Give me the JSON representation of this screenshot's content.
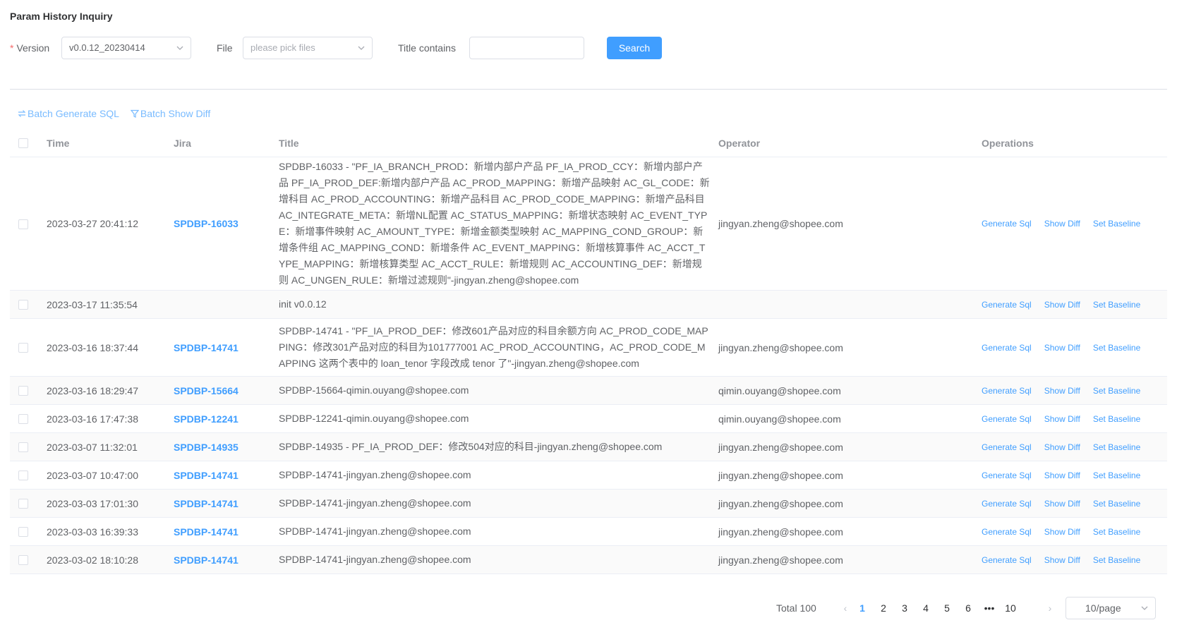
{
  "page": {
    "title": "Param History Inquiry"
  },
  "filters": {
    "version_label": "Version",
    "version_required_mark": "*",
    "version_value": "v0.0.12_20230414",
    "file_label": "File",
    "file_placeholder": "please pick files",
    "title_label": "Title contains",
    "title_value": "",
    "search_label": "Search"
  },
  "batch": {
    "generate_sql_label": "Batch Generate SQL",
    "show_diff_label": "Batch Show Diff"
  },
  "table": {
    "columns": {
      "time": "Time",
      "jira": "Jira",
      "title": "Title",
      "operator": "Operator",
      "operations": "Operations"
    },
    "op_labels": {
      "generate_sql": "Generate Sql",
      "show_diff": "Show Diff",
      "set_baseline": "Set Baseline"
    },
    "rows": [
      {
        "time": "2023-03-27 20:41:12",
        "jira": "SPDBP-16033",
        "title": "SPDBP-16033 - \"PF_IA_BRANCH_PROD：新增内部户产品 PF_IA_PROD_CCY：新增内部户产品 PF_IA_PROD_DEF:新增内部户产品 AC_PROD_MAPPING：新增产品映射 AC_GL_CODE：新增科目 AC_PROD_ACCOUNTING：新增产品科目 AC_PROD_CODE_MAPPING：新增产品科目 AC_INTEGRATE_META：新增NL配置 AC_STATUS_MAPPING：新增状态映射 AC_EVENT_TYPE：新增事件映射 AC_AMOUNT_TYPE：新增金额类型映射 AC_MAPPING_COND_GROUP：新增条件组 AC_MAPPING_COND：新增条件 AC_EVENT_MAPPING：新增核算事件 AC_ACCT_TYPE_MAPPING：新增核算类型 AC_ACCT_RULE：新增规则 AC_ACCOUNTING_DEF：新增规则 AC_UNGEN_RULE：新增过滤规则\"-jingyan.zheng@shopee.com",
        "operator": "jingyan.zheng@shopee.com"
      },
      {
        "time": "2023-03-17 11:35:54",
        "jira": "",
        "title": "init v0.0.12",
        "operator": ""
      },
      {
        "time": "2023-03-16 18:37:44",
        "jira": "SPDBP-14741",
        "title": "SPDBP-14741 - \"PF_IA_PROD_DEF：修改601产品对应的科目余额方向 AC_PROD_CODE_MAPPING：修改301产品对应的科目为101777001 AC_PROD_ACCOUNTING，AC_PROD_CODE_MAPPING 这两个表中的 loan_tenor 字段改成 tenor 了\"-jingyan.zheng@shopee.com",
        "operator": "jingyan.zheng@shopee.com"
      },
      {
        "time": "2023-03-16 18:29:47",
        "jira": "SPDBP-15664",
        "title": "SPDBP-15664-qimin.ouyang@shopee.com",
        "operator": "qimin.ouyang@shopee.com"
      },
      {
        "time": "2023-03-16 17:47:38",
        "jira": "SPDBP-12241",
        "title": "SPDBP-12241-qimin.ouyang@shopee.com",
        "operator": "qimin.ouyang@shopee.com"
      },
      {
        "time": "2023-03-07 11:32:01",
        "jira": "SPDBP-14935",
        "title": "SPDBP-14935 - PF_IA_PROD_DEF：修改504对应的科目-jingyan.zheng@shopee.com",
        "operator": "jingyan.zheng@shopee.com"
      },
      {
        "time": "2023-03-07 10:47:00",
        "jira": "SPDBP-14741",
        "title": "SPDBP-14741-jingyan.zheng@shopee.com",
        "operator": "jingyan.zheng@shopee.com"
      },
      {
        "time": "2023-03-03 17:01:30",
        "jira": "SPDBP-14741",
        "title": "SPDBP-14741-jingyan.zheng@shopee.com",
        "operator": "jingyan.zheng@shopee.com"
      },
      {
        "time": "2023-03-03 16:39:33",
        "jira": "SPDBP-14741",
        "title": "SPDBP-14741-jingyan.zheng@shopee.com",
        "operator": "jingyan.zheng@shopee.com"
      },
      {
        "time": "2023-03-02 18:10:28",
        "jira": "SPDBP-14741",
        "title": "SPDBP-14741-jingyan.zheng@shopee.com",
        "operator": "jingyan.zheng@shopee.com"
      }
    ]
  },
  "pagination": {
    "total_label": "Total 100",
    "pages": [
      "1",
      "2",
      "3",
      "4",
      "5",
      "6",
      "•••",
      "10"
    ],
    "current": "1",
    "page_size": "10/page"
  },
  "colors": {
    "primary": "#409eff",
    "primary_light": "#79bbff",
    "required": "#f56c6c"
  }
}
